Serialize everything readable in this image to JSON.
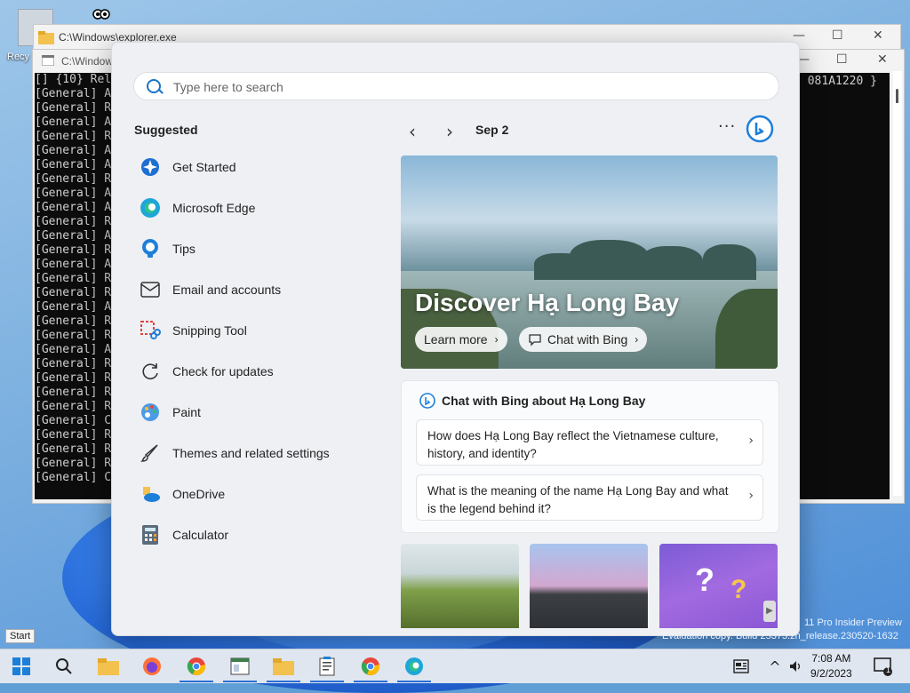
{
  "desktop": {
    "recycle_label": "Recy",
    "watermark_line1": "11 Pro Insider Preview",
    "watermark_line2": "Evaluation copy. Build 25375.zn_release.230520-1632",
    "start_tooltip": "Start"
  },
  "windows": {
    "explorer_title": "C:\\Windows\\explorer.exe",
    "console_title": "C:\\Window",
    "console_lines": [
      "[] {10} Rel",
      "[General] A",
      "[General] R",
      "[General] A",
      "[General] R",
      "[General] A",
      "[General] A",
      "[General] R",
      "[General] A",
      "[General] A",
      "[General] R",
      "[General] A",
      "[General] R",
      "[General] A",
      "[General] R",
      "[General] R",
      "[General] A",
      "[General] R",
      "[General] R",
      "[General] A",
      "[General] R",
      "[General] R",
      "[General] R",
      "[General] R",
      "[General] C",
      "[General] R",
      "[General] R",
      "[General] R",
      "[General] C"
    ],
    "console_right": "081A1220 }"
  },
  "start_menu": {
    "search_placeholder": "Type here to search",
    "suggested_heading": "Suggested",
    "suggested": [
      {
        "label": "Get Started",
        "icon": "get-started-icon"
      },
      {
        "label": "Microsoft Edge",
        "icon": "edge-icon"
      },
      {
        "label": "Tips",
        "icon": "tips-icon"
      },
      {
        "label": "Email and accounts",
        "icon": "mail-icon"
      },
      {
        "label": "Snipping Tool",
        "icon": "snipping-tool-icon"
      },
      {
        "label": "Check for updates",
        "icon": "refresh-icon"
      },
      {
        "label": "Paint",
        "icon": "paint-icon"
      },
      {
        "label": "Themes and related settings",
        "icon": "brush-icon"
      },
      {
        "label": "OneDrive",
        "icon": "onedrive-icon"
      },
      {
        "label": "Calculator",
        "icon": "calculator-icon"
      }
    ],
    "date": "Sep 2",
    "hero": {
      "title": "Discover Hạ Long Bay",
      "learn_more": "Learn more",
      "chat_with_bing": "Chat with Bing"
    },
    "chat": {
      "heading": "Chat with Bing about Hạ Long Bay",
      "questions": [
        "How does Hạ Long Bay reflect the Vietnamese culture, history, and identity?",
        "What is the meaning of the name Hạ Long Bay and what is the legend behind it?"
      ]
    }
  },
  "taskbar": {
    "time": "7:08 AM",
    "date": "9/2/2023",
    "notification_count": "1",
    "accent": "#2a6fd6"
  }
}
